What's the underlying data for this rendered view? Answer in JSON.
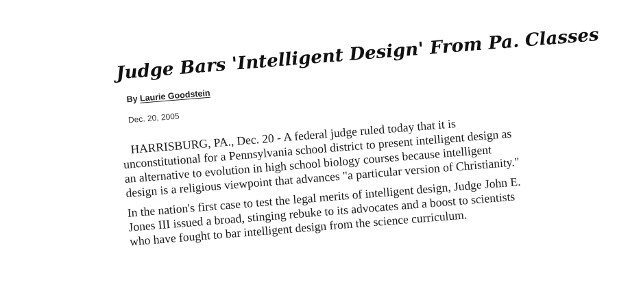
{
  "article": {
    "headline": "Judge Bars 'Intelligent Design' From Pa. Classes",
    "byline_prefix": "By ",
    "author": "Laurie Goodstein",
    "date": "Dec. 20, 2005",
    "paragraphs": [
      "HARRISBURG, PA., Dec. 20 - A federal judge ruled today that it is unconstitutional for a Pennsylvania school district to present intelligent design as an alternative to evolution in high school biology courses because intelligent design is a religious viewpoint that advances \"a particular version of Christianity.\"",
      "In the nation's first case to test the legal merits of intelligent design, Judge John E. Jones III issued a broad, stinging rebuke to its advocates and a boost to scientists who have fought to bar intelligent design from the science curriculum."
    ]
  }
}
